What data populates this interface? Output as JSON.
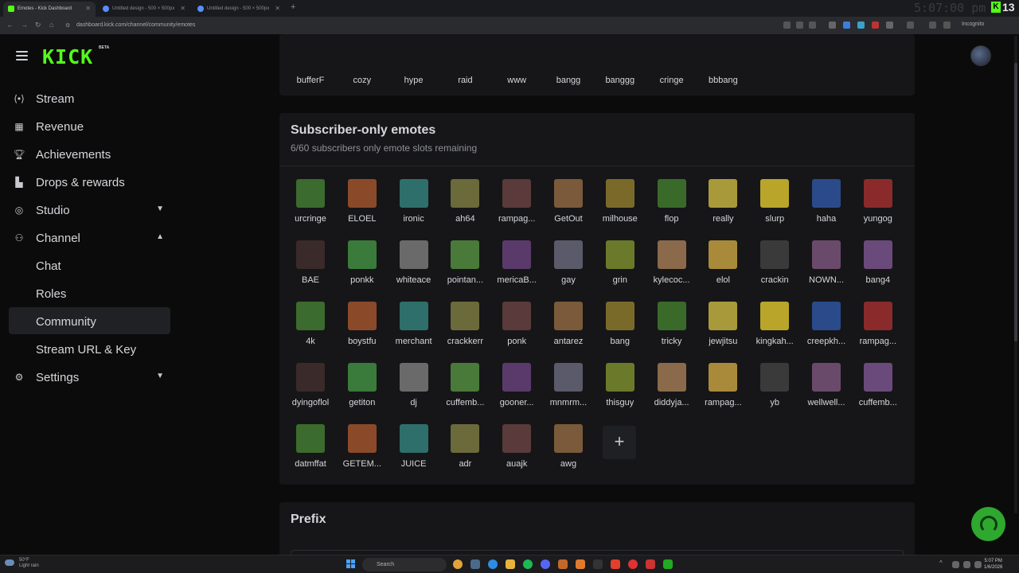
{
  "browser": {
    "tabs": [
      {
        "title": "Emotes - Kick Dashboard",
        "active": true,
        "favicon_color": "#53fc18"
      },
      {
        "title": "Untitled design - 500 × 500px",
        "active": false,
        "favicon_color": "#5b8cff"
      },
      {
        "title": "Untitled design - 500 × 500px",
        "active": false,
        "favicon_color": "#5b8cff"
      }
    ],
    "new_tab": "+",
    "url": "dashboard.kick.com/channel/community/emotes",
    "incognito_label": "Incognito",
    "overlay_clock": "5:07:00 pm",
    "kick_overlay_count": "13",
    "twitch_overlay_count": "0"
  },
  "header": {
    "logo": "KICK",
    "logo_badge": "BETA"
  },
  "sidebar": {
    "items": [
      {
        "label": "Stream",
        "icon": "broadcast-icon"
      },
      {
        "label": "Revenue",
        "icon": "revenue-icon"
      },
      {
        "label": "Achievements",
        "icon": "trophy-icon"
      },
      {
        "label": "Drops & rewards",
        "icon": "gift-icon"
      },
      {
        "label": "Studio",
        "icon": "studio-icon"
      },
      {
        "label": "Channel",
        "icon": "users-icon"
      },
      {
        "label": "Settings",
        "icon": "gear-icon"
      }
    ],
    "channel_subitems": [
      "Chat",
      "Roles",
      "Community",
      "Stream URL & Key"
    ],
    "active_subitem": "Community"
  },
  "top_emotes": [
    "bufferF",
    "cozy",
    "hype",
    "raid",
    "www",
    "bangg",
    "banggg",
    "cringe",
    "bbbang"
  ],
  "subscriber_emotes": {
    "title": "Subscriber-only emotes",
    "description": "6/60 subscribers only emote slots remaining",
    "rows": [
      [
        "urcringe",
        "ELOEL",
        "ironic",
        "ah64",
        "rampag...",
        "GetOut",
        "milhouse",
        "flop",
        "really",
        "slurp",
        "haha",
        "yungog"
      ],
      [
        "BAE",
        "ponkk",
        "whiteace",
        "pointan...",
        "mericaB...",
        "gay",
        "grin",
        "kylecoc...",
        "elol",
        "crackin",
        "NOWN...",
        "bang4"
      ],
      [
        "4k",
        "boystfu",
        "merchant",
        "crackkerr",
        "ponk",
        "antarez",
        "bang",
        "tricky",
        "jewjitsu",
        "kingkah...",
        "creepkh...",
        "rampag..."
      ],
      [
        "dyingoflol",
        "getiton",
        "dj",
        "cuffemb...",
        "gooner...",
        "mnmrm...",
        "thisguy",
        "diddyja...",
        "rampag...",
        "yb",
        "wellwell...",
        "cuffemb..."
      ],
      [
        "datmffat",
        "GETEM...",
        "JUICE",
        "adr",
        "auajk",
        "awg"
      ]
    ],
    "add_button": "+"
  },
  "prefix": {
    "title": "Prefix"
  },
  "taskbar": {
    "weather_temp": "50°F",
    "weather_desc": "Light rain",
    "search_placeholder": "Search",
    "time": "5:07 PM",
    "date": "1/6/2026"
  },
  "colors": {
    "accent": "#53fc18",
    "support_button": "#2ea82f"
  }
}
